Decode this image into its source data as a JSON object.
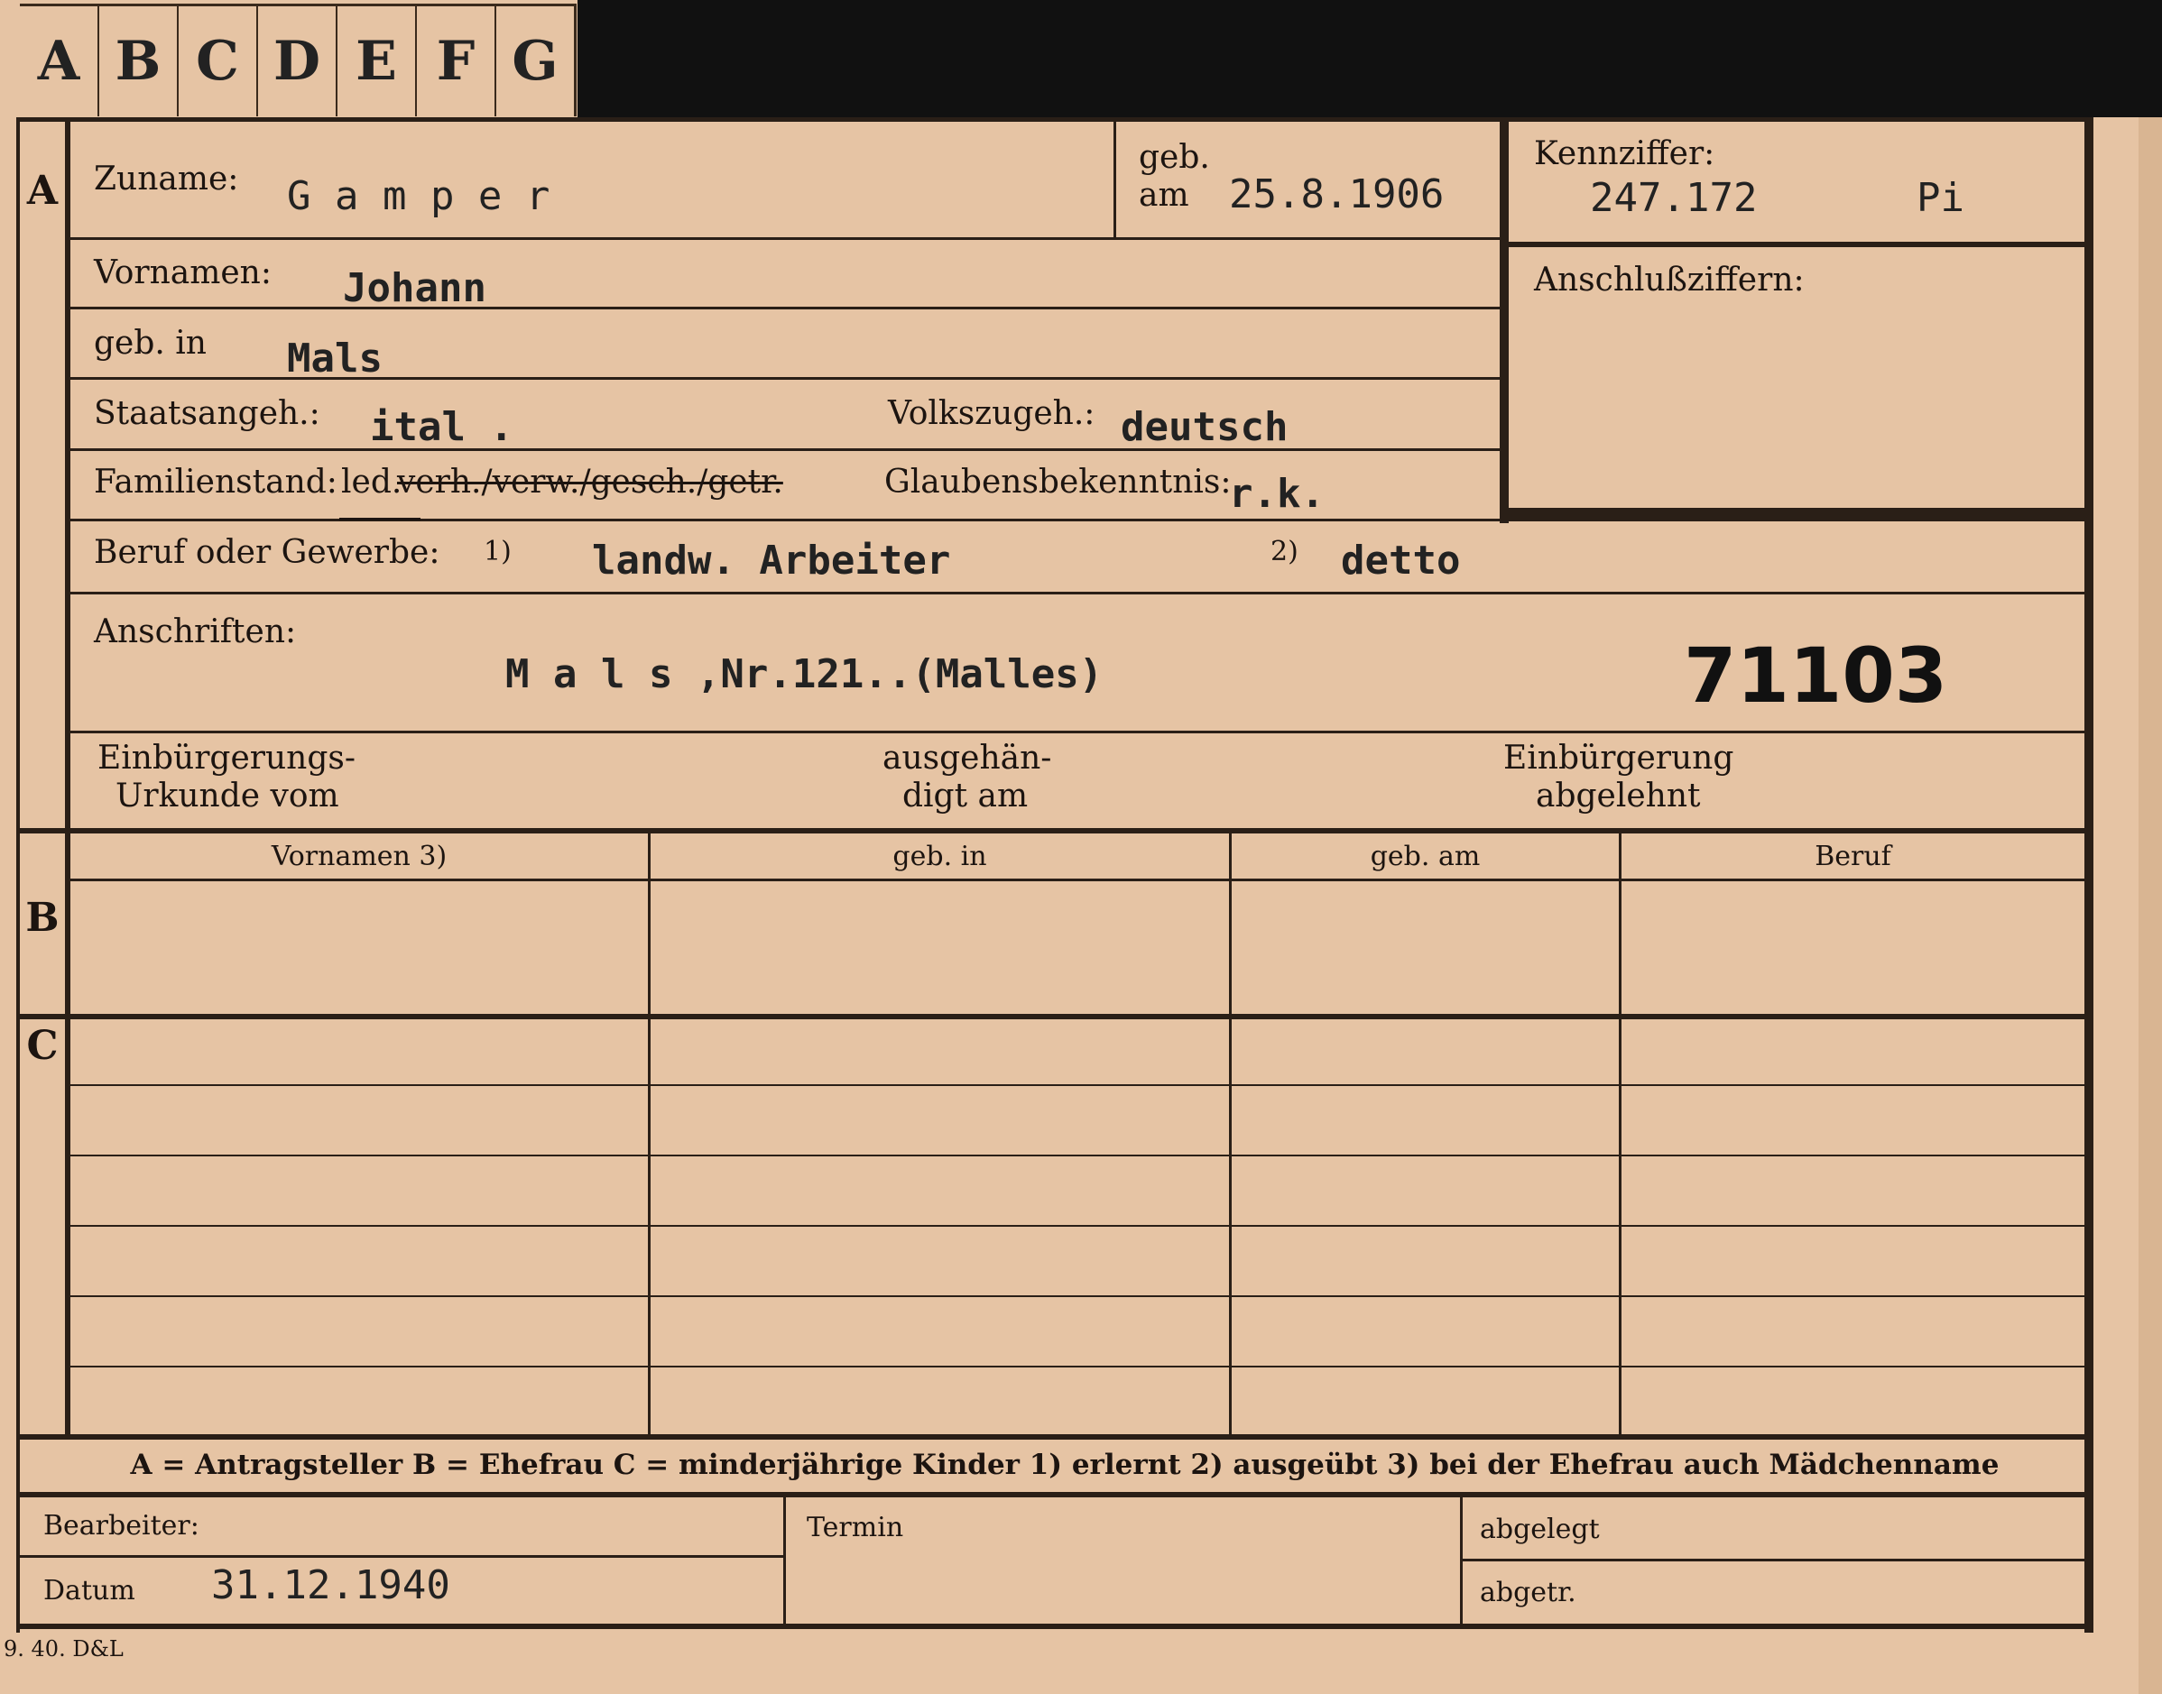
{
  "tabs": [
    "A",
    "B",
    "C",
    "D",
    "E",
    "F",
    "G"
  ],
  "sections": {
    "a": "A",
    "b": "B",
    "c": "C"
  },
  "fields": {
    "zuname_label": "Zuname:",
    "zuname": "G a m p e r",
    "geb_label_1": "geb.",
    "geb_label_2": "am",
    "geb_am": "25.8.1906",
    "kennziffer_label": "Kennziffer:",
    "kennziffer": "247.172",
    "kennziffer_suffix": "Pi",
    "anschlussziffern_label": "Anschlußziffern:",
    "vornamen_label": "Vornamen:",
    "vornamen": "Johann",
    "geb_in_label": "geb. in",
    "geb_in": "Mals",
    "staatsangeh_label": "Staatsangeh.:",
    "staatsangeh": "ital .",
    "volkszugeh_label": "Volkszugeh.:",
    "volkszugeh": "deutsch",
    "familienstand_label": "Familienstand:",
    "familienstand_selected": "led.",
    "familienstand_struck": "verh./verw./gesch./getr.",
    "glaubens_label": "Glaubensbekenntnis:",
    "glaubens": "r.k.",
    "beruf_label": "Beruf oder Gewerbe:",
    "beruf_fn1": "1)",
    "beruf_1": "landw. Arbeiter",
    "beruf_fn2": "2)",
    "beruf_2": "detto",
    "anschriften_label": "Anschriften:",
    "anschrift": "M a l s ,Nr.121..(Malles)",
    "stamp_number": "71103",
    "einb_urkunde_1": "Einbürgerungs-",
    "einb_urkunde_2": "Urkunde vom",
    "ausgehaendigt_1": "ausgehän-",
    "ausgehaendigt_2": "digt am",
    "einb_abgelehnt_1": "Einbürgerung",
    "einb_abgelehnt_2": "abgelehnt"
  },
  "table_headers": [
    "Vornamen 3)",
    "geb. in",
    "geb. am",
    "Beruf"
  ],
  "legend": "A = Antragsteller    B = Ehefrau    C = minderjährige Kinder    1) erlernt    2) ausgeübt    3) bei der Ehefrau auch Mädchenname",
  "footer": {
    "bearbeiter_label": "Bearbeiter:",
    "datum_label": "Datum",
    "datum": "31.12.1940",
    "termin_label": "Termin",
    "abgelegt_label": "abgelegt",
    "abgetr_label": "abgetr.",
    "print_code": "9. 40. D&L"
  },
  "colors": {
    "card": "#e6c4a4",
    "ink": "#2a1f17",
    "background": "#111111"
  }
}
